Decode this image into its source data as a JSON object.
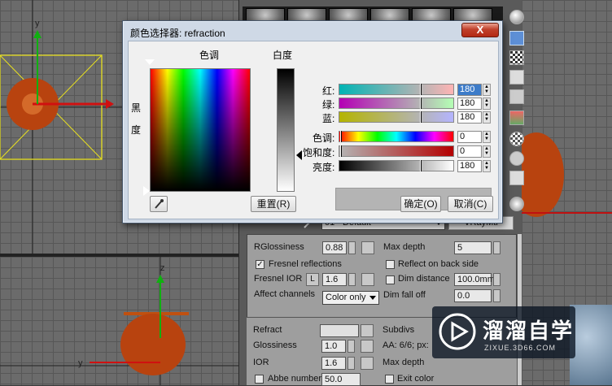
{
  "dialog": {
    "title": "颜色选择器: refraction",
    "close_label": "X",
    "hue_label": "色调",
    "whiteness_label": "白度",
    "blackness_label_1": "黑",
    "blackness_label_2": "度",
    "channels": [
      {
        "label": "红:",
        "value": "180"
      },
      {
        "label": "绿:",
        "value": "180"
      },
      {
        "label": "蓝:",
        "value": "180"
      }
    ],
    "hsv": [
      {
        "label": "色调:",
        "value": "0"
      },
      {
        "label": "饱和度:",
        "value": "0"
      },
      {
        "label": "亮度:",
        "value": "180"
      }
    ],
    "reset_label": "重置(R)",
    "ok_label": "确定(O)",
    "cancel_label": "取消(C)",
    "preview_color": "#b4b4b4"
  },
  "material": {
    "name": "01 - Default",
    "type": "VRayMtl"
  },
  "params": {
    "rglossiness_label": "RGlossiness",
    "rglossiness_value": "0.88",
    "max_depth_label": "Max depth",
    "max_depth_value": "5",
    "fresnel_label": "Fresnel reflections",
    "reflect_back_label": "Reflect on back side",
    "fresnel_ior_label": "Fresnel IOR",
    "fresnel_ior_lock": "L",
    "fresnel_ior_value": "1.6",
    "dim_distance_label": "Dim distance",
    "dim_distance_value": "100.0mm",
    "affect_channels_label": "Affect channels",
    "affect_channels_value": "Color only",
    "dim_falloff_label": "Dim fall off",
    "dim_falloff_value": "0.0",
    "refract_label": "Refract",
    "subdivs_label": "Subdivs",
    "glossiness_label": "Glossiness",
    "glossiness_value": "1.0",
    "aa_label": "AA: 6/6; px:",
    "ior_label": "IOR",
    "ior_value": "1.6",
    "max_depth2_label": "Max depth",
    "abbe_label": "Abbe number",
    "abbe_value": "50.0",
    "exit_color_label": "Exit color"
  },
  "watermark": {
    "brand": "溜溜自学",
    "url": "ZIXUE.3D66.COM"
  },
  "viewport": {
    "axis_y": "y",
    "axis_z": "z"
  }
}
